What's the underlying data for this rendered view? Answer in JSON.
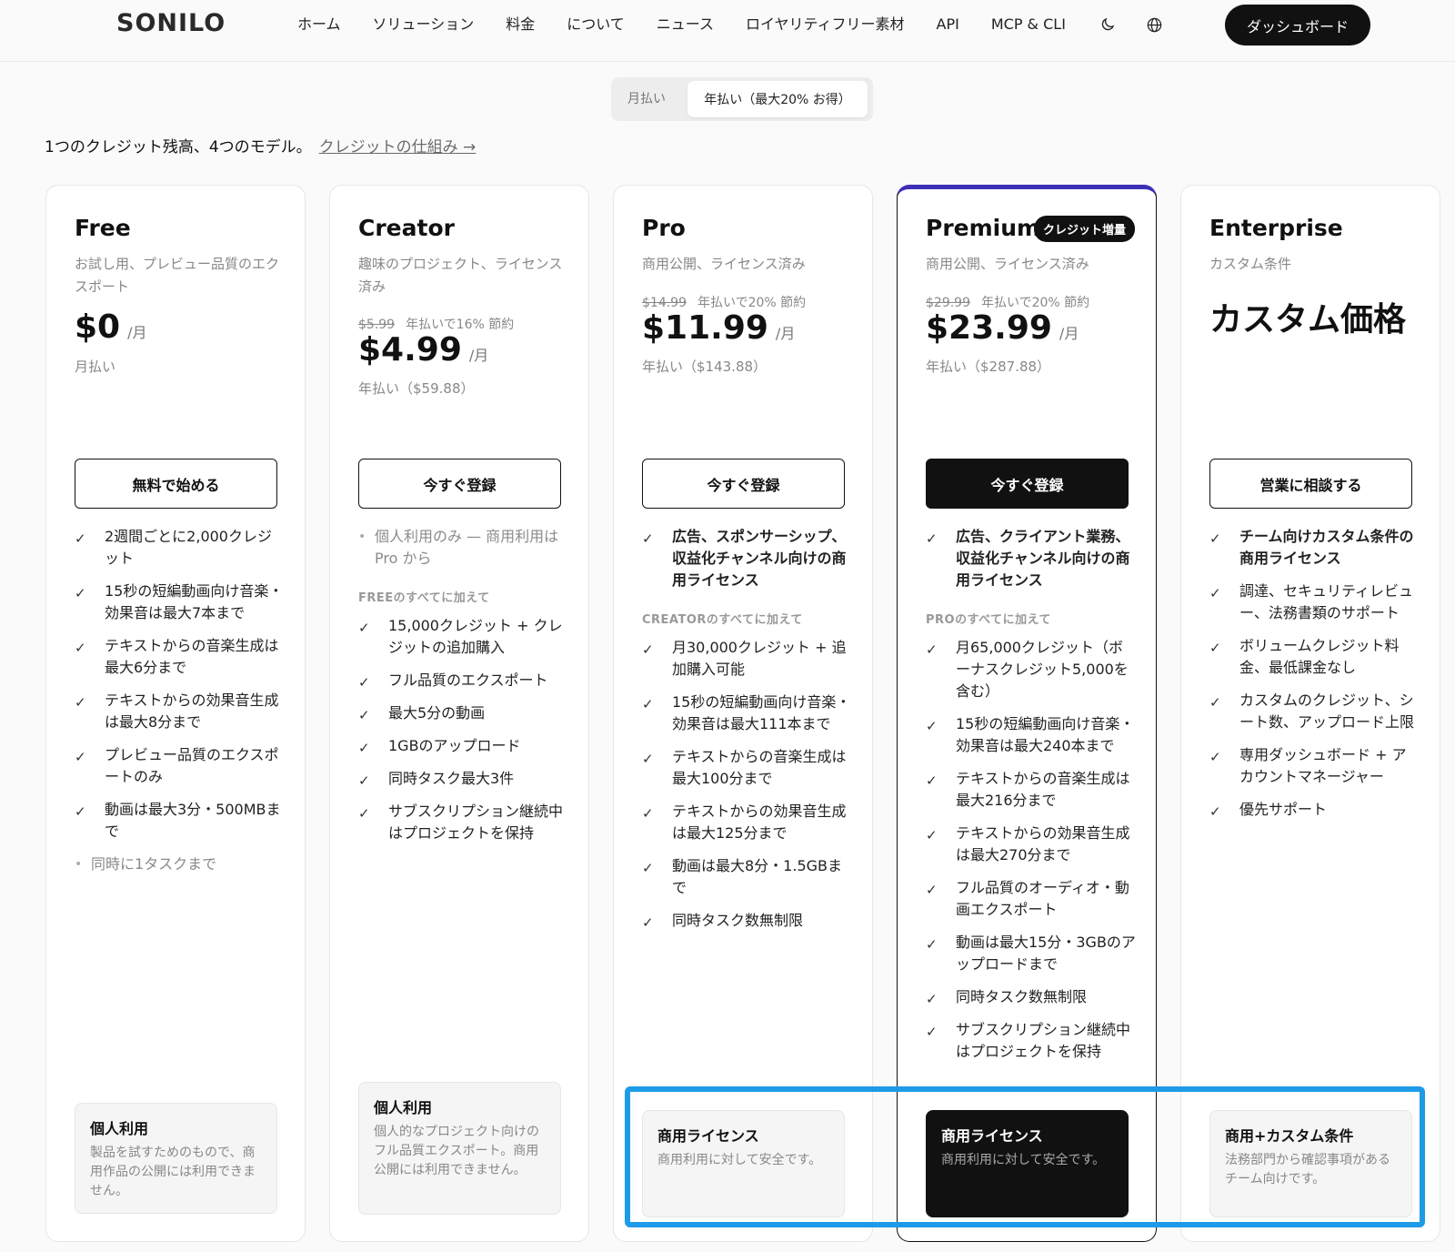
{
  "header": {
    "logo": "SONILO",
    "nav": [
      "ホーム",
      "ソリューション",
      "料金",
      "について",
      "ニュース",
      "ロイヤリティフリー素材",
      "API",
      "MCP & CLI"
    ],
    "dashboard": "ダッシュボード"
  },
  "billing": {
    "monthly": "月払い",
    "annual": "年払い（最大20% お得）"
  },
  "subtitle": {
    "text": "1つのクレジット残高、4つのモデル。",
    "link": "クレジットの仕組み →"
  },
  "plans": {
    "free": {
      "name": "Free",
      "desc": "お試し用、プレビュー品質のエクスポート",
      "price": "$0",
      "per": "/月",
      "note": "月払い",
      "cta": "無料で始める",
      "features": [
        "2週間ごとに2,000クレジット",
        "15秒の短編動画向け音楽・効果音は最大7本まで",
        "テキストからの音楽生成は最大6分まで",
        "テキストからの効果音生成は最大8分まで",
        "プレビュー品質のエクスポートのみ",
        "動画は最大3分・500MBまで"
      ],
      "muted": "同時に1タスクまで",
      "box_title": "個人利用",
      "box_text": "製品を試すためのもので、商用作品の公開には利用できません。"
    },
    "creator": {
      "name": "Creator",
      "desc": "趣味のプロジェクト、ライセンス済み",
      "strike": "$5.99",
      "save": "年払いで16% 節約",
      "price": "$4.99",
      "per": "/月",
      "note": "年払い（$59.88）",
      "cta": "今すぐ登録",
      "muted": "個人利用のみ — 商用利用は Pro から",
      "section": "FREEのすべてに加えて",
      "features": [
        "15,000クレジット + クレジットの追加購入",
        "フル品質のエクスポート",
        "最大5分の動画",
        "1GBのアップロード",
        "同時タスク最大3件",
        "サブスクリプション継続中はプロジェクトを保持"
      ],
      "box_title": "個人利用",
      "box_text": "個人的なプロジェクト向けのフル品質エクスポート。商用公開には利用できません。"
    },
    "pro": {
      "name": "Pro",
      "desc": "商用公開、ライセンス済み",
      "strike": "$14.99",
      "save": "年払いで20% 節約",
      "price": "$11.99",
      "per": "/月",
      "note": "年払い（$143.88）",
      "cta": "今すぐ登録",
      "lead": "広告、スポンサーシップ、収益化チャンネル向けの商用ライセンス",
      "section": "CREATORのすべてに加えて",
      "features": [
        "月30,000クレジット + 追加購入可能",
        "15秒の短編動画向け音楽・効果音は最大111本まで",
        "テキストからの音楽生成は最大100分まで",
        "テキストからの効果音生成は最大125分まで",
        "動画は最大8分・1.5GBまで",
        "同時タスク数無制限"
      ],
      "box_title": "商用ライセンス",
      "box_text": "商用利用に対して安全です。"
    },
    "premium": {
      "name": "Premium",
      "badge": "クレジット増量",
      "desc": "商用公開、ライセンス済み",
      "strike": "$29.99",
      "save": "年払いで20% 節約",
      "price": "$23.99",
      "per": "/月",
      "note": "年払い（$287.88）",
      "cta": "今すぐ登録",
      "lead": "広告、クライアント業務、収益化チャンネル向けの商用ライセンス",
      "section": "PROのすべてに加えて",
      "features": [
        "月65,000クレジット（ボーナスクレジット5,000を含む）",
        "15秒の短編動画向け音楽・効果音は最大240本まで",
        "テキストからの音楽生成は最大216分まで",
        "テキストからの効果音生成は最大270分まで",
        "フル品質のオーディオ・動画エクスポート",
        "動画は最大15分・3GBのアップロードまで",
        "同時タスク数無制限",
        "サブスクリプション継続中はプロジェクトを保持"
      ],
      "box_title": "商用ライセンス",
      "box_text": "商用利用に対して安全です。"
    },
    "enterprise": {
      "name": "Enterprise",
      "desc": "カスタム条件",
      "price": "カスタム価格",
      "cta": "営業に相談する",
      "lead": "チーム向けカスタム条件の商用ライセンス",
      "features": [
        "調達、セキュリティレビュー、法務書類のサポート",
        "ボリュームクレジット料金、最低課金なし",
        "カスタムのクレジット、シート数、アップロード上限",
        "専用ダッシュボード + アカウントマネージャー",
        "優先サポート"
      ],
      "box_title": "商用+カスタム条件",
      "box_text": "法務部門から確認事項があるチーム向けです。"
    }
  },
  "colors": {
    "accent": "#3d2fb8",
    "highlight": "#1e9be8",
    "primary": "#111111"
  }
}
